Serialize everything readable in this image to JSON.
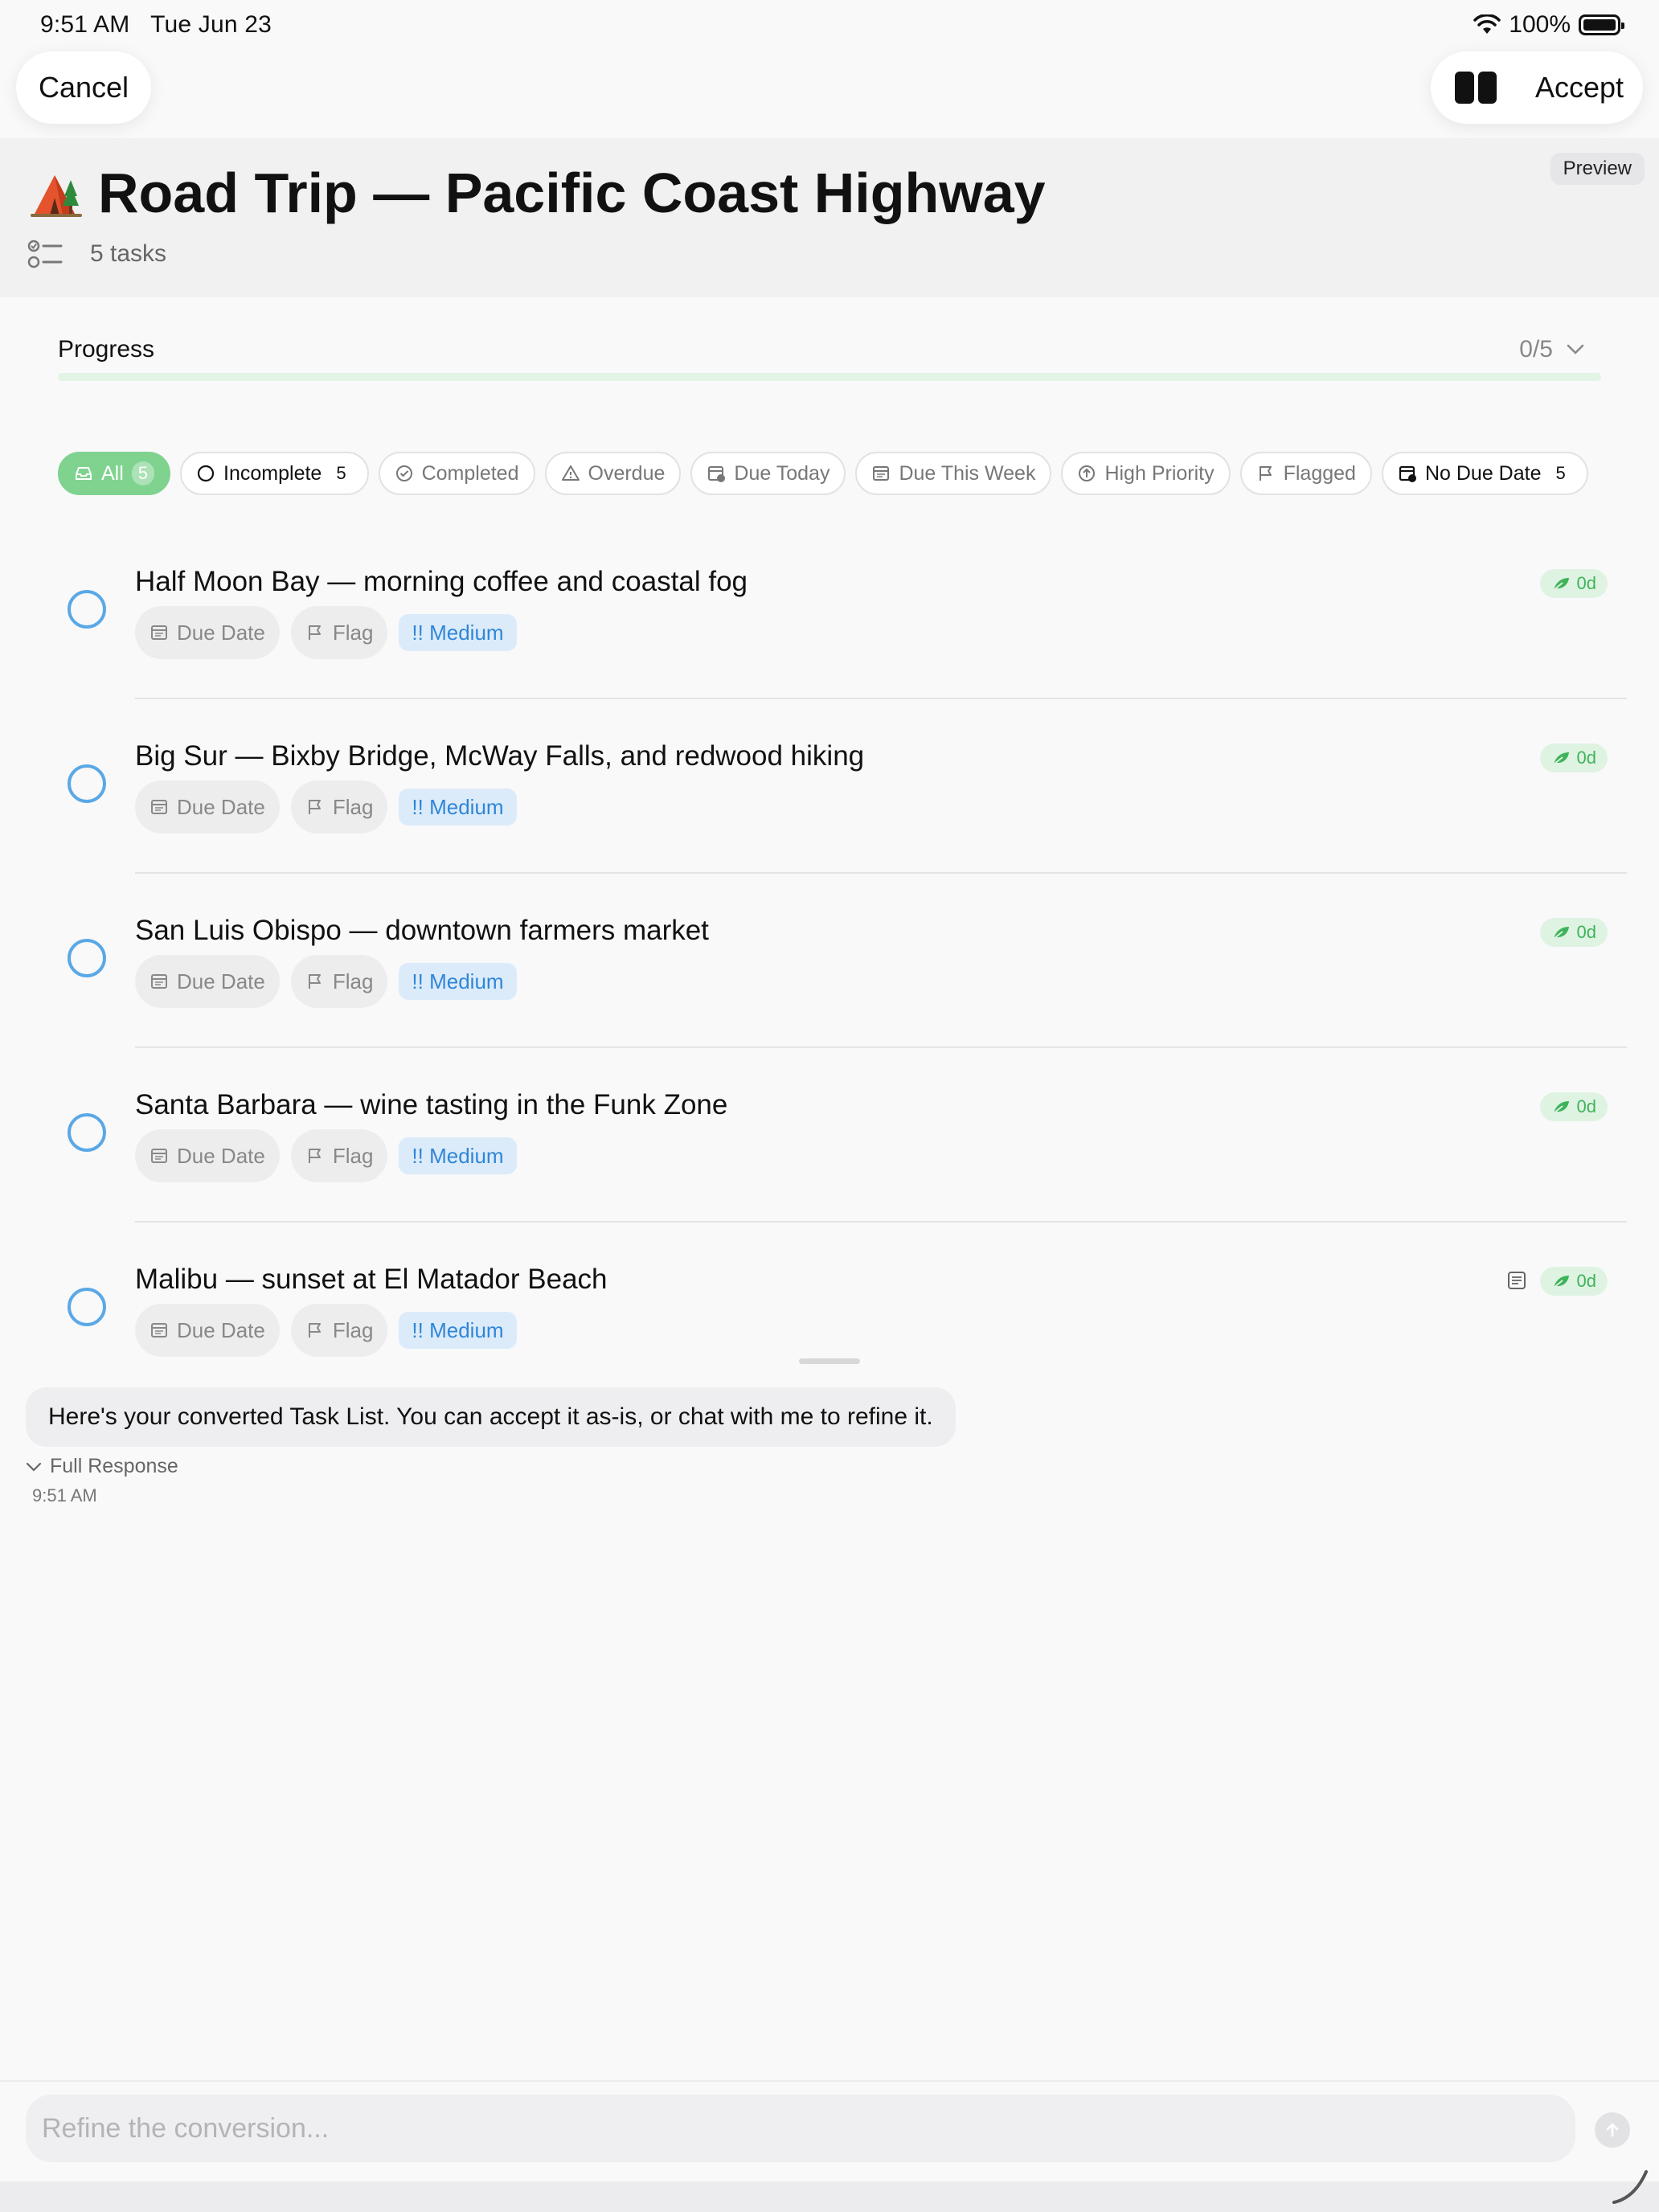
{
  "status_bar": {
    "time": "9:51 AM",
    "date": "Tue Jun 23",
    "battery": "100%"
  },
  "nav": {
    "cancel_label": "Cancel",
    "accept_label": "Accept",
    "preview_label": "Preview"
  },
  "list": {
    "icon": "camping-tent-icon",
    "title": "Road Trip — Pacific Coast Highway",
    "task_count": "5 tasks"
  },
  "progress": {
    "label": "Progress",
    "value": "0/5",
    "completed": 0,
    "total": 5,
    "color": "#4cc764"
  },
  "filters": [
    {
      "label": "All",
      "count": "5",
      "icon": "tray-icon",
      "active": true
    },
    {
      "label": "Incomplete",
      "count": "5",
      "icon": "circle-icon"
    },
    {
      "label": "Completed",
      "count": "",
      "icon": "check-circle-icon"
    },
    {
      "label": "Overdue",
      "count": "",
      "icon": "warning-icon"
    },
    {
      "label": "Due Today",
      "count": "",
      "icon": "calendar-clock-icon"
    },
    {
      "label": "Due This Week",
      "count": "",
      "icon": "calendar-icon"
    },
    {
      "label": "High Priority",
      "count": "",
      "icon": "arrow-up-circle-icon"
    },
    {
      "label": "Flagged",
      "count": "",
      "icon": "flag-icon"
    },
    {
      "label": "No Due Date",
      "count": "5",
      "icon": "calendar-slash-icon"
    }
  ],
  "tasks": [
    {
      "title": "Half Moon Bay — morning coffee and coastal fog",
      "due_label": "Due Date",
      "flag_label": "Flag",
      "priority": "!! Medium",
      "age": "0d",
      "has_notes": false
    },
    {
      "title": "Big Sur — Bixby Bridge, McWay Falls, and redwood hiking",
      "due_label": "Due Date",
      "flag_label": "Flag",
      "priority": "!! Medium",
      "age": "0d",
      "has_notes": false
    },
    {
      "title": "San Luis Obispo — downtown farmers market",
      "due_label": "Due Date",
      "flag_label": "Flag",
      "priority": "!! Medium",
      "age": "0d",
      "has_notes": false
    },
    {
      "title": "Santa Barbara — wine tasting in the Funk Zone",
      "due_label": "Due Date",
      "flag_label": "Flag",
      "priority": "!! Medium",
      "age": "0d",
      "has_notes": false
    },
    {
      "title": "Malibu — sunset at El Matador Beach",
      "due_label": "Due Date",
      "flag_label": "Flag",
      "priority": "!! Medium",
      "age": "0d",
      "has_notes": true
    }
  ],
  "chat": {
    "message": "Here's your converted Task List. You can accept it as-is, or chat with me to refine it.",
    "full_response_label": "Full Response",
    "time": "9:51 AM"
  },
  "input": {
    "placeholder": "Refine the conversion..."
  },
  "colors": {
    "accent_green": "#4cc764",
    "checkbox_blue": "#5aa8e6",
    "priority_blue": "#2f86d6"
  }
}
